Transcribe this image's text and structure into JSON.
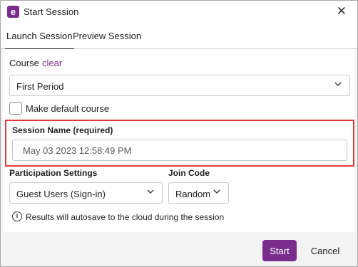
{
  "window": {
    "title": "Start Session",
    "app_icon_letter": "e",
    "close_glyph": "✕"
  },
  "tabs": [
    {
      "label": "Launch Session",
      "active": true
    },
    {
      "label": "Preview Session",
      "active": false
    }
  ],
  "course": {
    "label": "Course",
    "clear_link": "clear",
    "selected": "First Period",
    "make_default_label": "Make default course",
    "make_default_checked": false
  },
  "session": {
    "label": "Session Name",
    "required_note": "(required)",
    "placeholder": "May 03 2023 12:58:49 PM"
  },
  "participation": {
    "label": "Participation Settings",
    "selected": "Guest Users (Sign-in)"
  },
  "join_code": {
    "label": "Join Code",
    "selected": "Random"
  },
  "info": {
    "icon": "info-icon",
    "text": "Results will autosave to the cloud during the session"
  },
  "actions": {
    "start_label": "Start",
    "cancel_label": "Cancel"
  },
  "colors": {
    "accent": "#7b2d8e",
    "highlight_border": "#e0393e"
  }
}
